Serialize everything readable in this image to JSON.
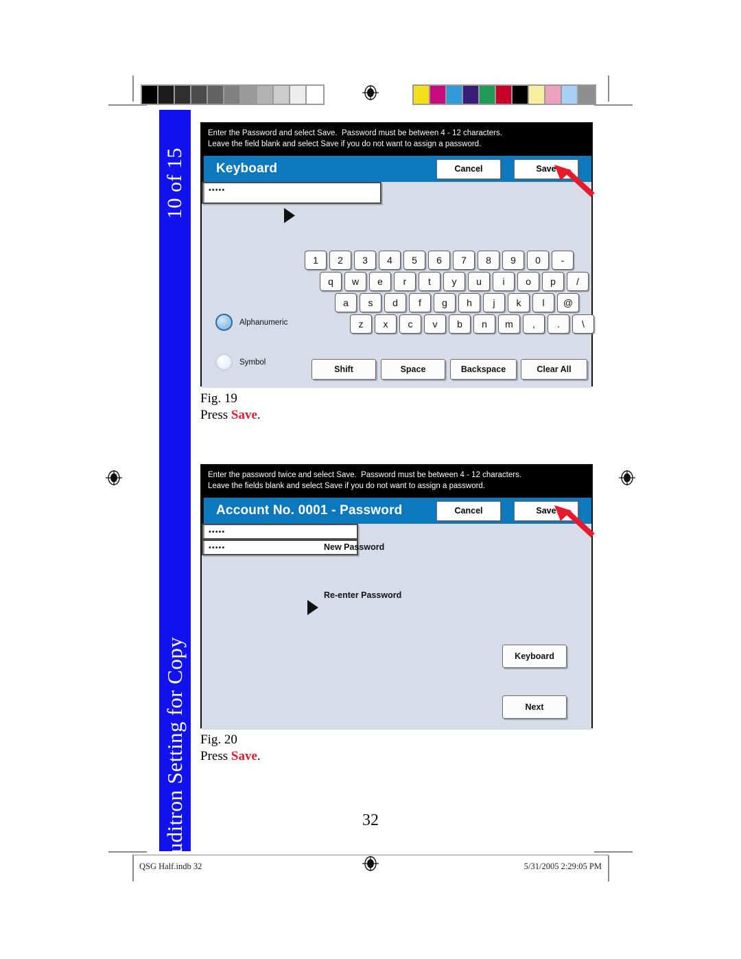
{
  "document": {
    "page_number": "32",
    "side_tab_top": "10 of 15",
    "side_tab_bottom": "Auditron Setting for Copy",
    "footer_left": "QSG Half.indb   32",
    "footer_right": "5/31/2005   2:29:05 PM"
  },
  "calibration": {
    "grayscale_swatches": [
      "#000000",
      "#1c1c1c",
      "#2f2f2f",
      "#4c4c4c",
      "#636363",
      "#808080",
      "#9a9a9a",
      "#b3b3b3",
      "#cccccc",
      "#ededed",
      "#ffffff"
    ],
    "color_swatches": [
      "#f3e01a",
      "#c70a7c",
      "#2e9ad8",
      "#3b1b79",
      "#1f9a57",
      "#c90028",
      "#000000",
      "#f8eea0",
      "#eca0bd",
      "#a7d0f2",
      "#8e8e8e"
    ]
  },
  "figures": [
    {
      "caption_label": "Fig.  19",
      "caption_prefix": "Press ",
      "caption_highlight": "Save",
      "caption_suffix": ".",
      "banner_line1": "Enter the Password and select Save.  Password must be between 4 - 12 characters.",
      "banner_line2": "Leave the field blank and select Save if you do not want to assign a password.",
      "title": "Keyboard",
      "cancel_label": "Cancel",
      "save_label": "Save",
      "password_value": "•••••",
      "keyboard_rows": [
        [
          "1",
          "2",
          "3",
          "4",
          "5",
          "6",
          "7",
          "8",
          "9",
          "0",
          "-"
        ],
        [
          "q",
          "w",
          "e",
          "r",
          "t",
          "y",
          "u",
          "i",
          "o",
          "p",
          "/"
        ],
        [
          "a",
          "s",
          "d",
          "f",
          "g",
          "h",
          "j",
          "k",
          "l",
          "@"
        ],
        [
          "z",
          "x",
          "c",
          "v",
          "b",
          "n",
          "m",
          ",",
          ".",
          "\\"
        ]
      ],
      "mode_options": [
        {
          "label": "Alphanumeric",
          "selected": true
        },
        {
          "label": "Symbol",
          "selected": false
        }
      ],
      "action_buttons": [
        "Shift",
        "Space",
        "Backspace",
        "Clear All"
      ]
    },
    {
      "caption_label": "Fig.  20",
      "caption_prefix": "Press ",
      "caption_highlight": "Save",
      "caption_suffix": ".",
      "banner_line1": "Enter the password twice and select Save.  Password must be between 4 - 12 characters.",
      "banner_line2": "Leave the fields blank and select Save if you do not want to assign a password.",
      "title": "Account No. 0001 - Password",
      "cancel_label": "Cancel",
      "save_label": "Save",
      "new_password_label": "New Password",
      "new_password_value": "•••••",
      "reenter_password_label": "Re-enter Password",
      "reenter_password_value": "•••••",
      "keyboard_button": "Keyboard",
      "next_button": "Next"
    }
  ],
  "colors": {
    "titlebar_blue": "#0c79be",
    "tab_blue": "#1212ef",
    "panel_gray": "#d6dde8",
    "callout_red": "#e8192c",
    "banner_black": "#000000"
  }
}
